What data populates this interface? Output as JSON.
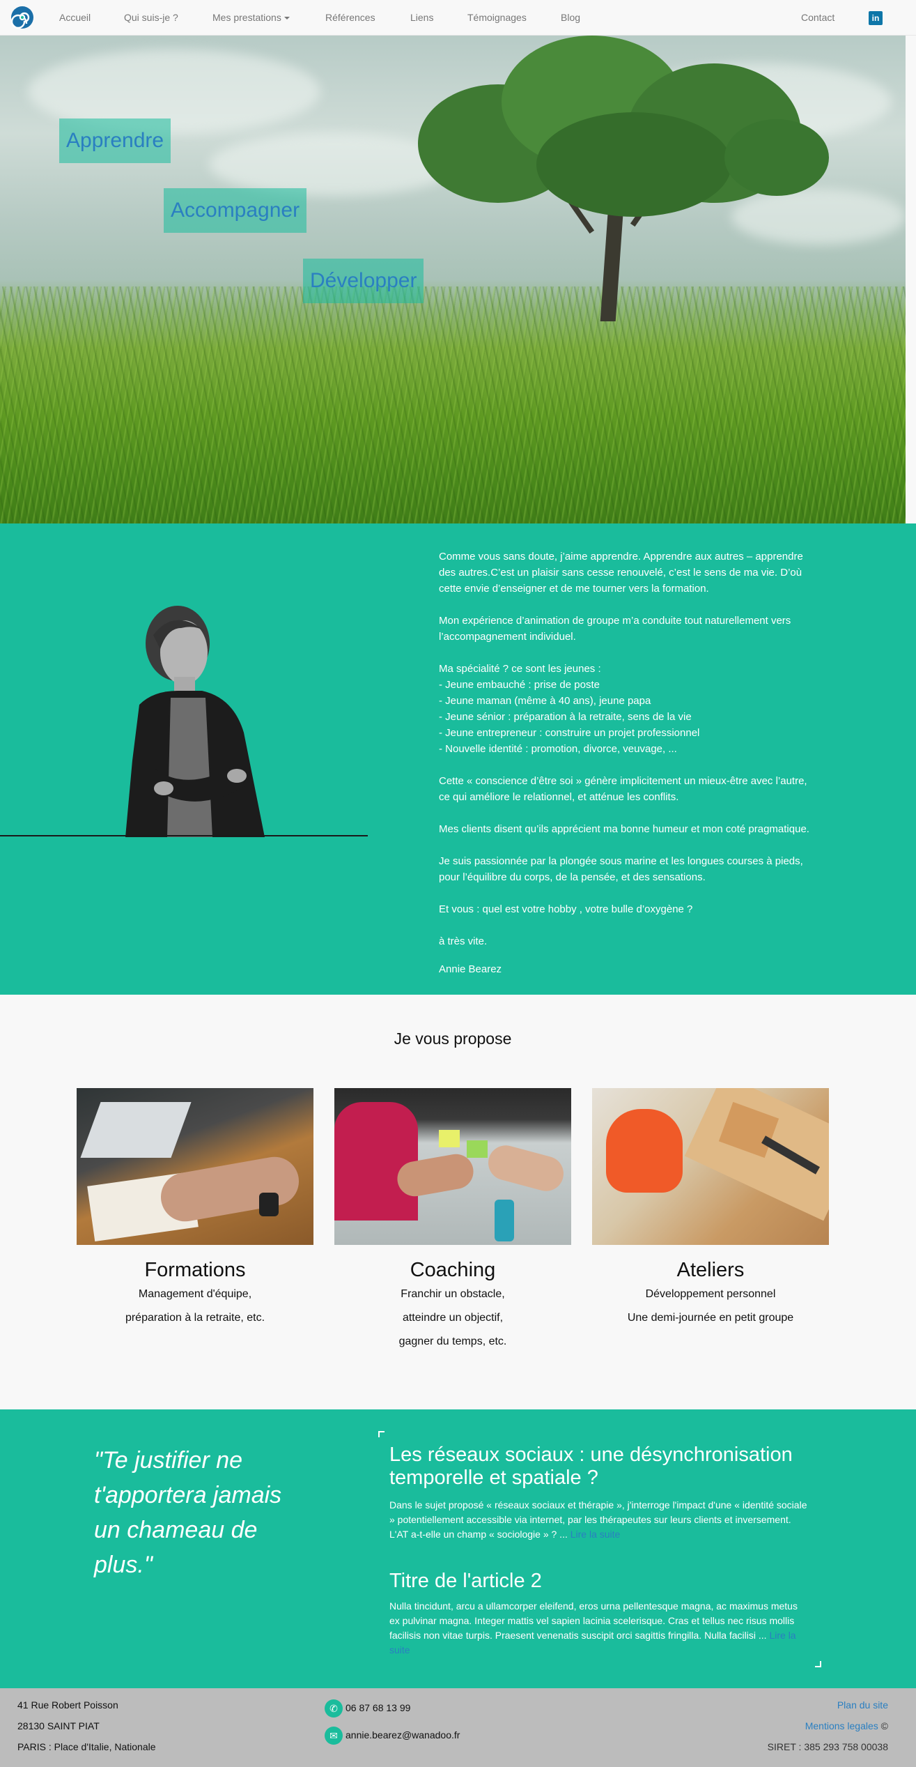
{
  "nav": {
    "logo": "spiral-logo",
    "items": [
      "Accueil",
      "Qui suis-je ?",
      "Mes prestations",
      "Références",
      "Liens",
      "Témoignages",
      "Blog"
    ],
    "contact": "Contact",
    "linkedin_icon": "linkedin-icon"
  },
  "hero": {
    "tags": [
      "Apprendre",
      "Accompagner",
      "Développer"
    ]
  },
  "about": {
    "p1": "Comme vous sans doute, j’aime apprendre. Apprendre aux autres – apprendre des autres.C’est un plaisir sans cesse renouvelé, c’est le sens de ma vie. D’où cette envie d’enseigner et de me tourner vers la formation.",
    "p2": "Mon expérience d’animation de groupe m’a conduite tout naturellement vers l’accompagnement individuel.",
    "p3_intro": "Ma spécialité ? ce sont les jeunes :",
    "p3_items": [
      "- Jeune embauché : prise de poste",
      "- Jeune maman (même à 40 ans), jeune papa",
      "- Jeune sénior : préparation à la retraite, sens de la vie",
      "- Jeune entrepreneur : construire un projet professionnel",
      "- Nouvelle identité : promotion, divorce, veuvage, ..."
    ],
    "p4": "Cette « conscience d’être soi » génère implicitement un mieux-être avec l’autre, ce qui améliore le relationnel, et atténue les conflits.",
    "p5": "Mes clients disent qu’ils apprécient ma bonne humeur et mon coté pragmatique.",
    "p6": "Je suis passionnée par la plongée sous marine et les longues courses à pieds, pour l’équilibre du corps, de la pensée, et des sensations.",
    "p7": "Et vous : quel est votre hobby , votre bulle d’oxygène ?",
    "p8": "à très vite.",
    "signature": "Annie Bearez"
  },
  "propose": {
    "title": "Je vous propose",
    "cards": [
      {
        "title": "Formations",
        "lines": [
          "Management d'équipe,",
          "préparation à la retraite, etc."
        ]
      },
      {
        "title": "Coaching",
        "lines": [
          "Franchir un obstacle,",
          "atteindre un objectif,",
          "gagner du temps, etc."
        ]
      },
      {
        "title": "Ateliers",
        "lines": [
          "Développement personnel",
          "Une demi-journée en petit groupe"
        ]
      }
    ]
  },
  "blog": {
    "quote": "\"Te justifier ne t'apportera jamais un chameau de plus.\"",
    "articles": [
      {
        "title": "Les réseaux sociaux : une désynchronisation temporelle et spatiale ?",
        "body": "Dans le sujet proposé « réseaux sociaux et thérapie », j'interroge l'impact d'une « identité sociale » potentiellement accessible via internet, par les thérapeutes sur leurs clients et inversement.",
        "body2": "L'AT a-t-elle un champ « sociologie » ? ...",
        "more": "Lire la suite"
      },
      {
        "title": "Titre de l'article 2",
        "body": "Nulla tincidunt, arcu a ullamcorper eleifend, eros urna pellentesque magna, ac maximus metus ex pulvinar magna. Integer mattis vel sapien lacinia scelerisque. Cras et tellus nec risus mollis facilisis non vitae turpis. Praesent venenatis suscipit orci sagittis fringilla. Nulla facilisi ...",
        "more": "Lire la suite"
      }
    ]
  },
  "footer": {
    "address1": "41 Rue Robert Poisson",
    "address2": "28130 SAINT PIAT",
    "address3": "PARIS : Place d'Italie, Nationale",
    "phone": "06 87 68 13 99",
    "email": "annie.bearez@wanadoo.fr",
    "sitemap": "Plan du site",
    "legal": "Mentions legales",
    "copyright": "©",
    "siret": "SIRET : 385 293 758 00038"
  },
  "colors": {
    "accent": "#1abc9c",
    "link": "#2a7fc1",
    "nav_bg": "#f8f8f8",
    "footer_bg": "#bcbcbc"
  }
}
